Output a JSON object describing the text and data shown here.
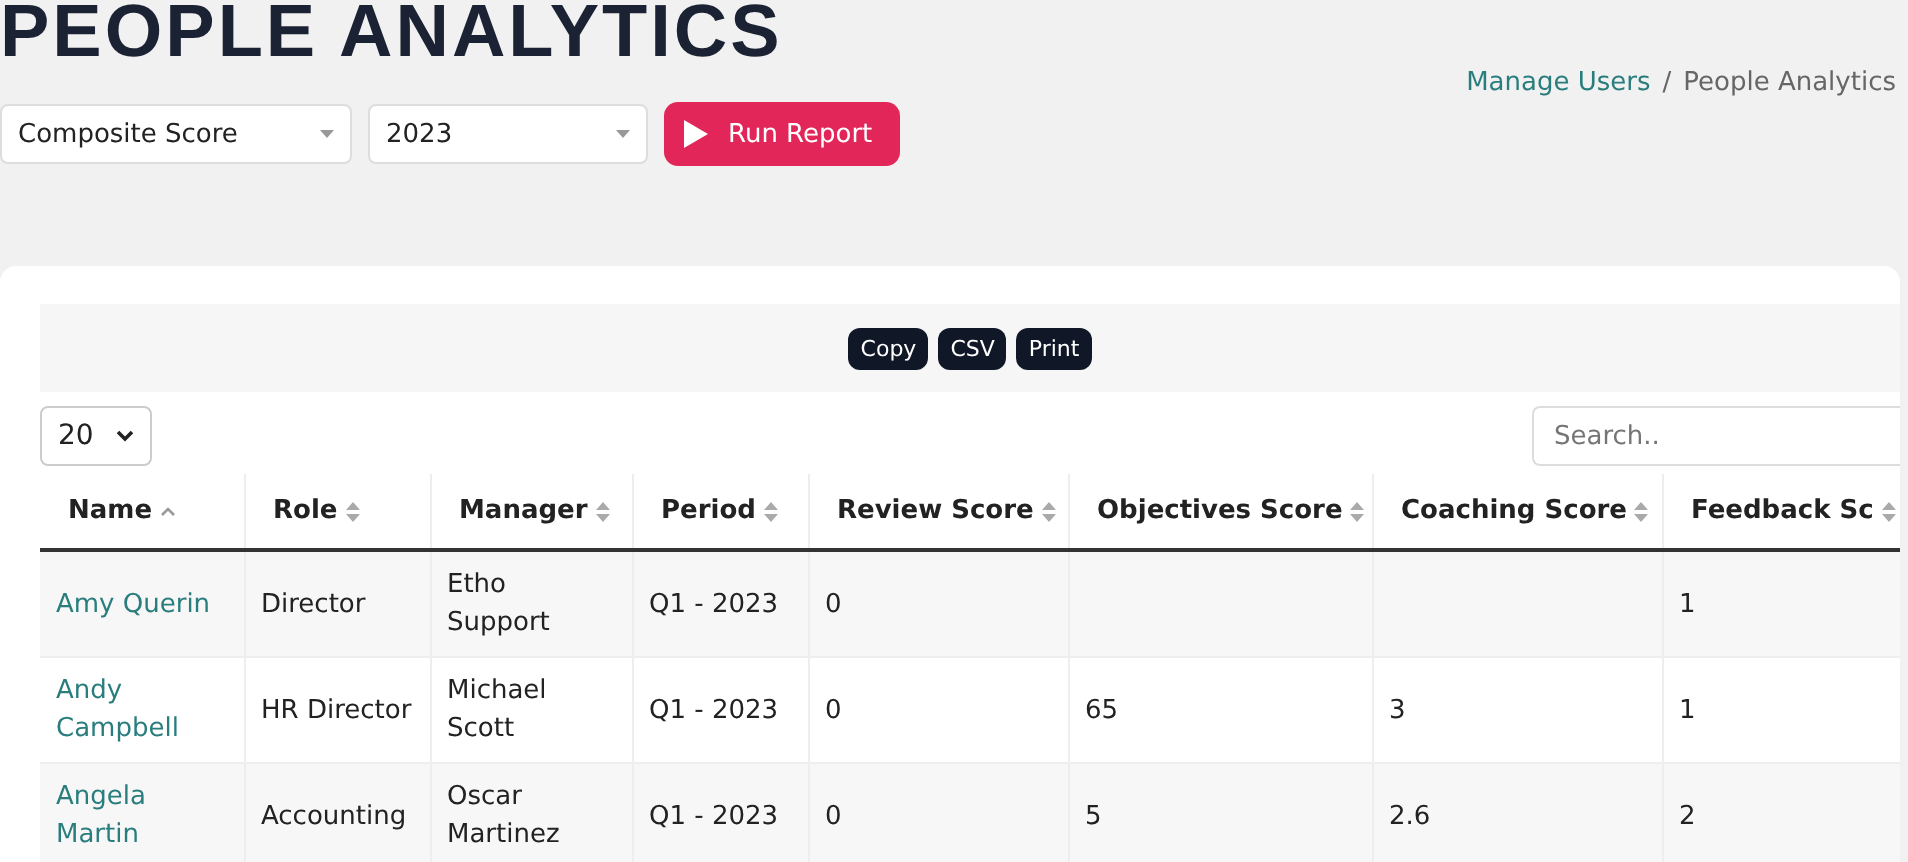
{
  "page_title": "PEOPLE ANALYTICS",
  "filters": [
    {
      "value": "Composite Score"
    },
    {
      "value": "2023"
    }
  ],
  "run_button": {
    "label": "Run Report"
  },
  "breadcrumb": {
    "separator": "/",
    "items": [
      {
        "label": "Manage Users",
        "link": true
      },
      {
        "label": "People Analytics",
        "link": false
      }
    ]
  },
  "export_buttons": [
    "Copy",
    "CSV",
    "Print"
  ],
  "page_length": "20",
  "search": {
    "placeholder": "Search.."
  },
  "table": {
    "columns": [
      {
        "label": "Name",
        "sorted": true
      },
      {
        "label": "Role",
        "sorted": false
      },
      {
        "label": "Manager",
        "sorted": false
      },
      {
        "label": "Period",
        "sorted": false
      },
      {
        "label": "Review Score",
        "sorted": false
      },
      {
        "label": "Objectives Score",
        "sorted": false
      },
      {
        "label": "Coaching Score",
        "sorted": false
      },
      {
        "label": "Feedback Sc",
        "sorted": false
      }
    ],
    "rows": [
      [
        "Amy Querin",
        "Director",
        "Etho Support",
        "Q1 - 2023",
        "0",
        "",
        "",
        "1"
      ],
      [
        "Andy Campbell",
        "HR Director",
        "Michael Scott",
        "Q1 - 2023",
        "0",
        "65",
        "3",
        "1"
      ],
      [
        "Angela Martin",
        "Accounting",
        "Oscar Martinez",
        "Q1 - 2023",
        "0",
        "5",
        "2.6",
        "2"
      ]
    ]
  }
}
